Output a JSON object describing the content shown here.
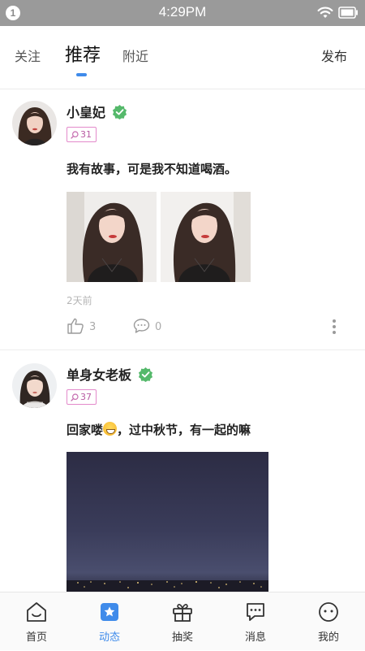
{
  "status_bar": {
    "notification_count": "1",
    "time": "4:29PM"
  },
  "top_nav": {
    "tabs": [
      {
        "label": "关注"
      },
      {
        "label": "推荐"
      },
      {
        "label": "附近"
      }
    ],
    "active_tab": "推荐",
    "publish_label": "发布",
    "accent_color": "#3f8bea"
  },
  "feed": {
    "posts": [
      {
        "username": "小皇妃",
        "verified": true,
        "badge": "31",
        "text": "我有故事，可是我不知道喝酒。",
        "photo_count": 2,
        "time_ago": "2天前",
        "likes": "3",
        "comments": "0"
      },
      {
        "username": "单身女老板",
        "verified": true,
        "badge": "37",
        "text_before_emoji": "回家喽",
        "text_after_emoji": "，过中秋节，有一起的嘛",
        "photo_count": 1
      }
    ]
  },
  "tab_bar": {
    "items": [
      {
        "label": "首页",
        "icon": "home-icon"
      },
      {
        "label": "动态",
        "icon": "star-square-icon"
      },
      {
        "label": "抽奖",
        "icon": "gift-icon"
      },
      {
        "label": "消息",
        "icon": "chat-bubble-icon"
      },
      {
        "label": "我的",
        "icon": "profile-face-icon"
      }
    ],
    "active": "动态"
  }
}
